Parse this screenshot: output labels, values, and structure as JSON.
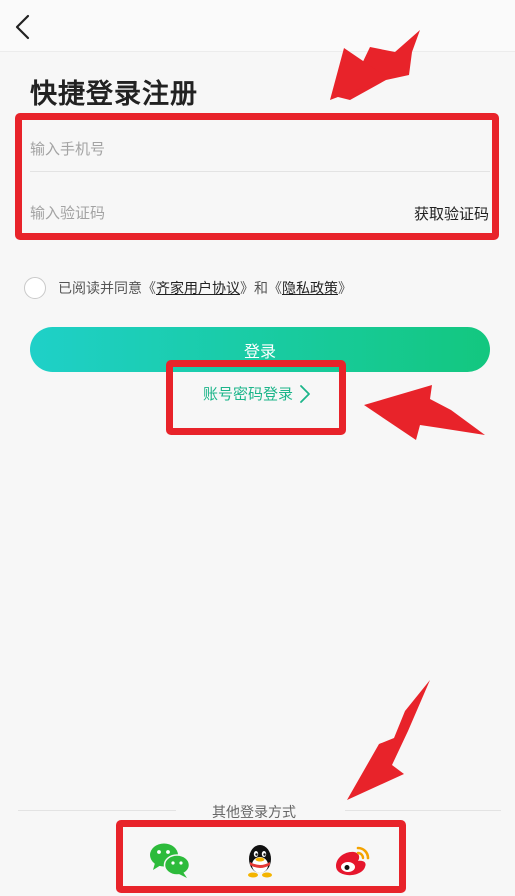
{
  "form": {
    "title": "快捷登录注册",
    "phone_placeholder": "输入手机号",
    "code_placeholder": "输入验证码",
    "get_code_label": "获取验证码"
  },
  "agreement": {
    "prefix": "已阅读并同意《",
    "user_agreement": "齐家用户协议",
    "middle": "》和《",
    "privacy_policy": "隐私政策",
    "suffix": "》"
  },
  "login_button_label": "登录",
  "account_login_label": "账号密码登录",
  "other_login": {
    "label": "其他登录方式",
    "methods": [
      "wechat-icon",
      "qq-icon",
      "weibo-icon"
    ]
  },
  "colors": {
    "accent": "#1cb58a",
    "gradient_start": "#1fd0c8",
    "gradient_end": "#13c77f",
    "highlight": "#e8232a"
  }
}
